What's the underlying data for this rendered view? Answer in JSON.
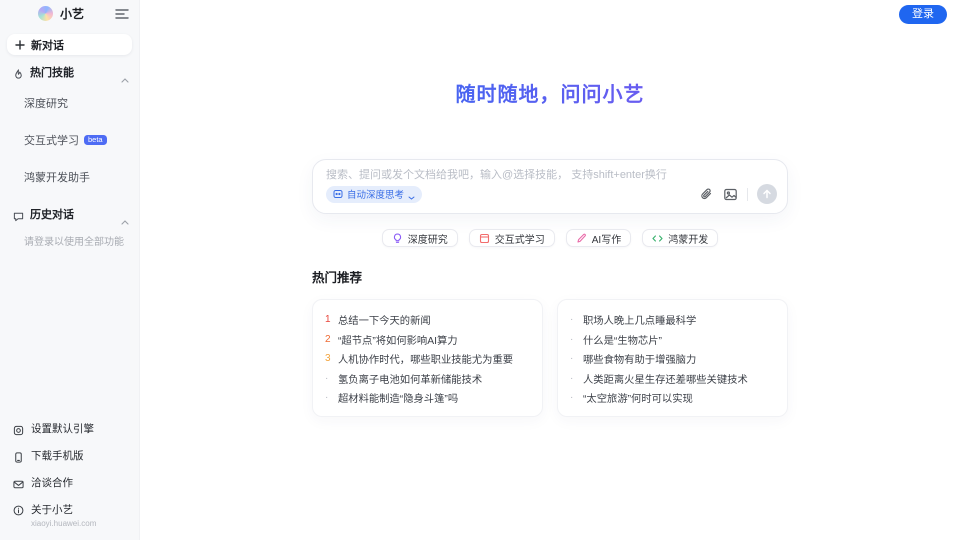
{
  "sidebar": {
    "app_name": "小艺",
    "new_chat_label": "新对话",
    "skills_section_label": "热门技能",
    "skills": [
      {
        "label": "深度研究"
      },
      {
        "label": "交互式学习",
        "badge": "beta"
      },
      {
        "label": "鸿蒙开发助手"
      }
    ],
    "history_section_label": "历史对话",
    "history_note": "请登录以使用全部功能",
    "footer": [
      {
        "label": "设置默认引擎"
      },
      {
        "label": "下载手机版"
      },
      {
        "label": "洽谈合作"
      },
      {
        "label": "关于小艺",
        "sub": "xiaoyi.huawei.com"
      }
    ]
  },
  "header": {
    "login_label": "登录"
  },
  "main": {
    "title": "随时随地，问问小艺",
    "search": {
      "placeholder": "搜索、提问或发个文档给我吧，输入@选择技能， 支持shift+enter换行",
      "mode_chip_label": "自动深度思考"
    },
    "skill_chips": [
      {
        "label": "深度研究",
        "icon_color": "#8b5cf6"
      },
      {
        "label": "交互式学习",
        "icon_color": "#f26d6d"
      },
      {
        "label": "AI写作",
        "icon_color": "#e96aa8"
      },
      {
        "label": "鸿蒙开发",
        "icon_color": "#3cb370"
      }
    ],
    "recommend": {
      "title": "热门推荐",
      "left": [
        {
          "marker": "1",
          "marker_color": "#e8463c",
          "text": "总结一下今天的新闻"
        },
        {
          "marker": "2",
          "marker_color": "#ee6a33",
          "text": "“超节点”将如何影响AI算力"
        },
        {
          "marker": "3",
          "marker_color": "#f2a33c",
          "text": "人机协作时代，哪些职业技能尤为重要"
        },
        {
          "marker": "·",
          "marker_color": "#b7bac1",
          "text": "氢负离子电池如何革新储能技术"
        },
        {
          "marker": "·",
          "marker_color": "#b7bac1",
          "text": "超材料能制造“隐身斗篷”吗"
        }
      ],
      "right": [
        {
          "marker": "·",
          "marker_color": "#b7bac1",
          "text": "职场人晚上几点睡最科学"
        },
        {
          "marker": "·",
          "marker_color": "#b7bac1",
          "text": "什么是“生物芯片”"
        },
        {
          "marker": "·",
          "marker_color": "#b7bac1",
          "text": "哪些食物有助于增强脑力"
        },
        {
          "marker": "·",
          "marker_color": "#b7bac1",
          "text": "人类距离火星生存还差哪些关键技术"
        },
        {
          "marker": "·",
          "marker_color": "#b7bac1",
          "text": "“太空旅游”何时可以实现"
        }
      ]
    }
  },
  "colors": {
    "accent_blue": "#1f66f0",
    "title_gradient_start": "#2e6af1",
    "title_gradient_end": "#8a55f0",
    "sidebar_bg": "#f7f8fa",
    "mode_chip_bg": "#e5edfc",
    "mode_chip_text": "#3a6ee6"
  }
}
